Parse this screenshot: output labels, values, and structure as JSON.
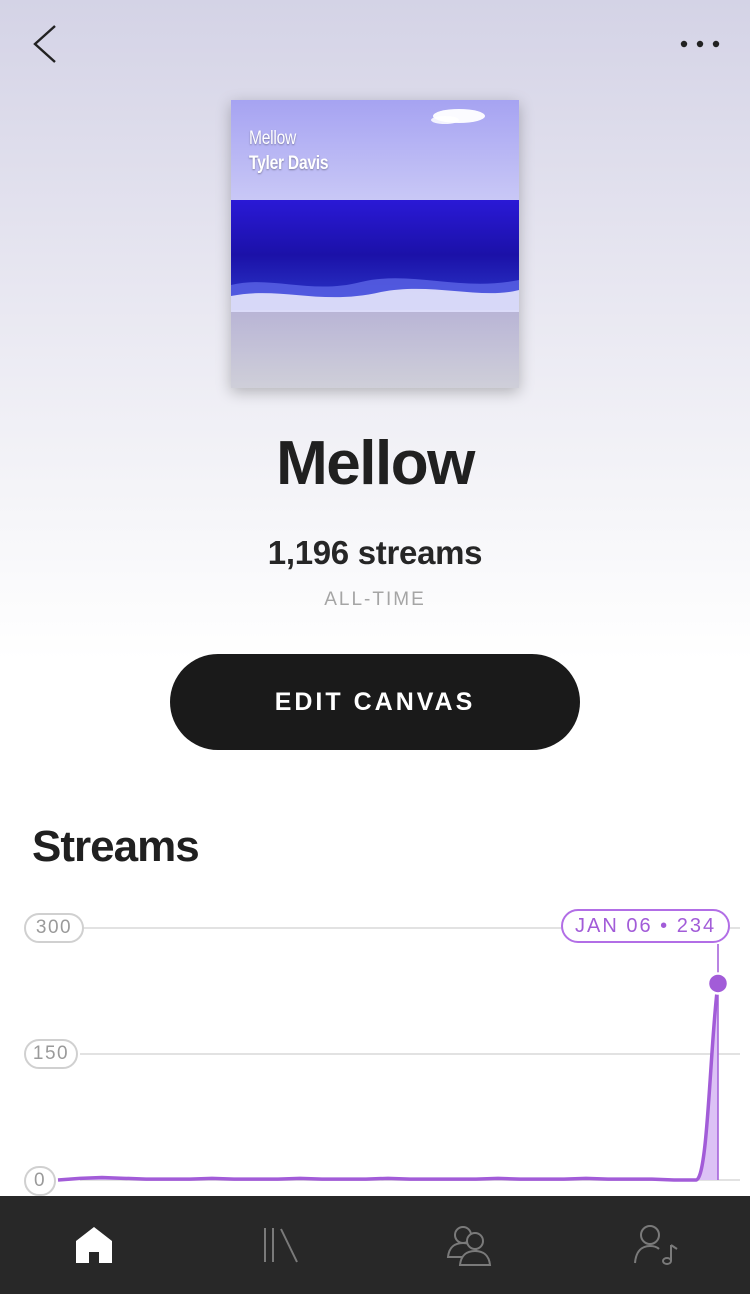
{
  "header": {
    "back_icon": "chevron-left-icon",
    "more_icon": "more-horizontal-icon"
  },
  "cover": {
    "title": "Mellow",
    "artist": "Tyler Davis"
  },
  "song": {
    "title": "Mellow",
    "streams": "1,196 streams",
    "period": "ALL-TIME"
  },
  "edit_button": {
    "label": "EDIT CANVAS"
  },
  "streams_section": {
    "title": "Streams"
  },
  "colors": {
    "accent": "#a25cd8",
    "fill": "#dcc2f5",
    "button": "#1a1a1a",
    "tab_bar": "#282828"
  },
  "chart_data": {
    "type": "area",
    "title": "",
    "xlabel": "",
    "ylabel": "",
    "ylim": [
      0,
      300
    ],
    "yticks": [
      "300",
      "150",
      "0"
    ],
    "grid": true,
    "series": [
      {
        "values": [
          0,
          2,
          3,
          2,
          1,
          1,
          1,
          2,
          1,
          1,
          1,
          2,
          1,
          1,
          1,
          2,
          1,
          1,
          1,
          1,
          2,
          1,
          1,
          1,
          2,
          1,
          1,
          1,
          0,
          0,
          234
        ]
      }
    ],
    "highlight": {
      "label": "JAN 06 • 234",
      "value": 234
    }
  },
  "tab_bar": {
    "items": [
      {
        "name": "home",
        "icon": "home-icon",
        "active": true
      },
      {
        "name": "library",
        "icon": "library-icon",
        "active": false
      },
      {
        "name": "audience",
        "icon": "audience-icon",
        "active": false
      },
      {
        "name": "profile",
        "icon": "artist-profile-icon",
        "active": false
      }
    ]
  }
}
